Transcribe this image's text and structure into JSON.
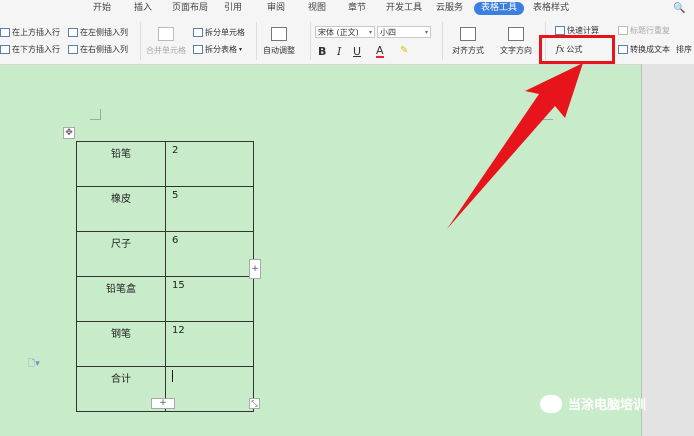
{
  "tabs": [
    {
      "label": "开始"
    },
    {
      "label": "插入"
    },
    {
      "label": "页面布局"
    },
    {
      "label": "引用"
    },
    {
      "label": "审阅"
    },
    {
      "label": "视图"
    },
    {
      "label": "章节"
    },
    {
      "label": "开发工具"
    },
    {
      "label": "云服务"
    },
    {
      "label": "表格工具",
      "active": true
    },
    {
      "label": "表格样式"
    }
  ],
  "ribbon": {
    "insert_above": "在上方插入行",
    "insert_left": "在左侧插入列",
    "insert_below": "在下方插入行",
    "insert_right": "在右侧插入列",
    "merge": "合并单元格",
    "split_cell": "拆分单元格",
    "split_table": "拆分表格",
    "autofit": "自动调整",
    "font_name": "宋体 (正文)",
    "font_size": "小四",
    "bold": "B",
    "italic": "I",
    "underline": "U",
    "font_color": "A",
    "align": "对齐方式",
    "text_dir": "文字方向",
    "quick_calc": "快速计算",
    "title_repeat": "标题行重复",
    "formula_icon": "fx",
    "formula": "公式",
    "to_text": "转换成文本",
    "sort": "排序"
  },
  "table": {
    "rows": [
      {
        "name": "铅笔",
        "value": "2"
      },
      {
        "name": "橡皮",
        "value": "5"
      },
      {
        "name": "尺子",
        "value": "6"
      },
      {
        "name": "铅笔盒",
        "value": "15"
      },
      {
        "name": "钢笔",
        "value": "12"
      },
      {
        "name": "合计",
        "value": ""
      }
    ]
  },
  "handles": {
    "add_row": "+",
    "add_col": "+",
    "move": "✥",
    "resize": "⤡"
  },
  "watermark": "当涂电脑培训",
  "colors": {
    "accent": "#3b7fe0",
    "highlight": "#e8141b",
    "page": "#c8ebc9"
  }
}
